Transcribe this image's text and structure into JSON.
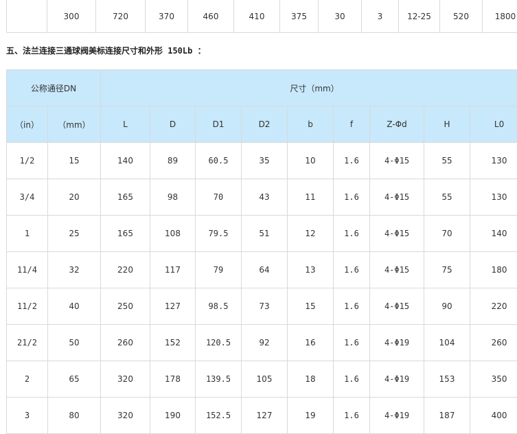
{
  "top_row": [
    "",
    "300",
    "720",
    "370",
    "460",
    "410",
    "375",
    "30",
    "3",
    "12-25",
    "520",
    "1800"
  ],
  "section_title": "五、法兰连接三通球阀美标连接尺寸和外形 150Lb ：",
  "header": {
    "nominal": "公称通径DN",
    "dimensions": "尺寸（mm）",
    "columns": [
      "（in）",
      "（mm）",
      "L",
      "D",
      "D1",
      "D2",
      "b",
      "f",
      "Z-Φd",
      "H",
      "L0"
    ]
  },
  "rows": [
    [
      "1/2",
      "15",
      "140",
      "89",
      "60.5",
      "35",
      "10",
      "1.6",
      "4-Φ15",
      "55",
      "130"
    ],
    [
      "3/4",
      "20",
      "165",
      "98",
      "70",
      "43",
      "11",
      "1.6",
      "4-Φ15",
      "55",
      "130"
    ],
    [
      "1",
      "25",
      "165",
      "108",
      "79.5",
      "51",
      "12",
      "1.6",
      "4-Φ15",
      "70",
      "140"
    ],
    [
      "11/4",
      "32",
      "220",
      "117",
      "79",
      "64",
      "13",
      "1.6",
      "4-Φ15",
      "75",
      "180"
    ],
    [
      "11/2",
      "40",
      "250",
      "127",
      "98.5",
      "73",
      "15",
      "1.6",
      "4-Φ15",
      "90",
      "220"
    ],
    [
      "21/2",
      "50",
      "260",
      "152",
      "120.5",
      "92",
      "16",
      "1.6",
      "4-Φ19",
      "104",
      "260"
    ],
    [
      "2",
      "65",
      "320",
      "178",
      "139.5",
      "105",
      "18",
      "1.6",
      "4-Φ19",
      "153",
      "350"
    ],
    [
      "3",
      "80",
      "320",
      "190",
      "152.5",
      "127",
      "19",
      "1.6",
      "4-Φ19",
      "187",
      "400"
    ]
  ]
}
